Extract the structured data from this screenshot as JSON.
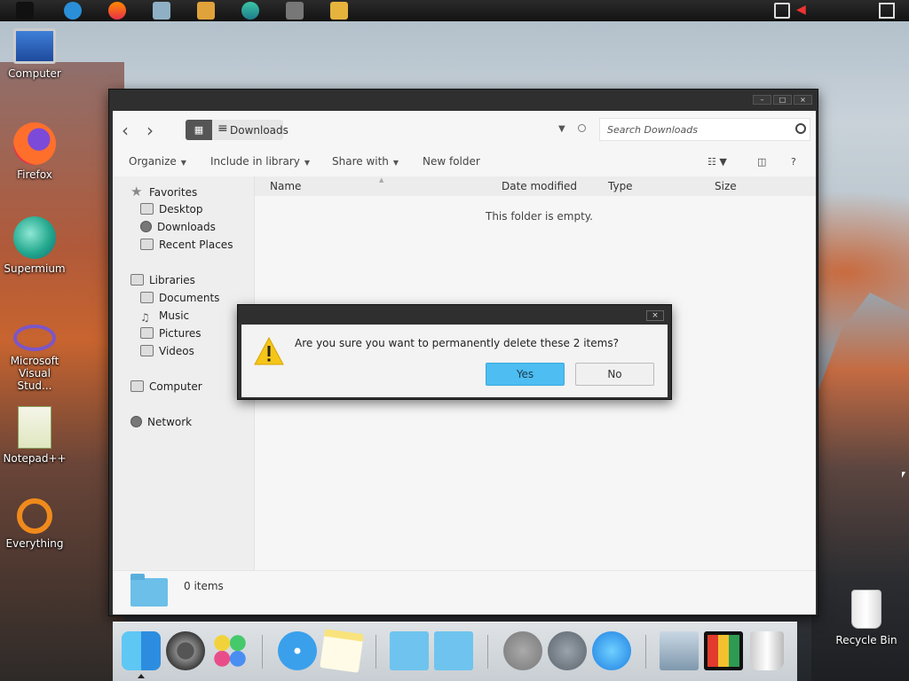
{
  "taskbar": {
    "apps": [
      "start-icon",
      "ie-icon",
      "firefox-icon",
      "explorer-icon",
      "media-player-icon",
      "supermium-icon",
      "camera-icon",
      "folder-app-icon"
    ],
    "tray": [
      "display-icon",
      "volume-muted-icon",
      "notification-icon"
    ]
  },
  "desktop": {
    "icons": [
      {
        "label": "Computer",
        "icon": "computer-icon"
      },
      {
        "label": "Firefox",
        "icon": "firefox-icon"
      },
      {
        "label": "Supermium",
        "icon": "supermium-icon"
      },
      {
        "label": "Microsoft Visual Stud...",
        "icon": "visual-studio-icon"
      },
      {
        "label": "Notepad++",
        "icon": "notepadpp-icon"
      },
      {
        "label": "Everything",
        "icon": "everything-icon"
      }
    ],
    "recycle_bin": "Recycle Bin"
  },
  "explorer": {
    "breadcrumb": "Downloads",
    "search_placeholder": "Search Downloads",
    "commands": [
      "Organize",
      "Include in library",
      "Share with",
      "New folder"
    ],
    "sidebar": {
      "favorites": "Favorites",
      "favorites_items": [
        "Desktop",
        "Downloads",
        "Recent Places"
      ],
      "libraries": "Libraries",
      "libraries_items": [
        "Documents",
        "Music",
        "Pictures",
        "Videos"
      ],
      "computer": "Computer",
      "network": "Network"
    },
    "columns": [
      "Name",
      "Date modified",
      "Type",
      "Size"
    ],
    "empty_message": "This folder is empty.",
    "item_count": "0 items"
  },
  "dialog": {
    "message": "Are you sure you want to permanently delete these 2 items?",
    "yes": "Yes",
    "no": "No",
    "close": "×"
  },
  "dock": {
    "items": [
      "finder-icon",
      "system-preferences-icon",
      "game-center-icon",
      "safari-icon",
      "notes-icon",
      "documents-folder-icon",
      "applications-folder-icon",
      "power-icon",
      "launchpad-icon",
      "app-store-icon",
      "preview-icon",
      "photo-booth-icon",
      "trash-icon"
    ]
  },
  "colors": {
    "accent": "#4dbdf2",
    "window_chrome": "#2f2f2f",
    "folder": "#6bbfe8"
  }
}
